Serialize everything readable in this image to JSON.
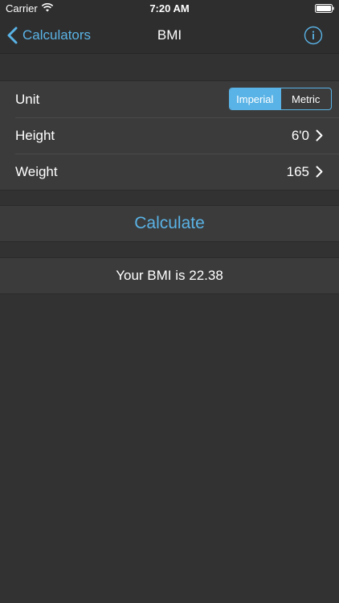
{
  "status_bar": {
    "carrier": "Carrier",
    "time": "7:20 AM"
  },
  "nav": {
    "back_label": "Calculators",
    "title": "BMI"
  },
  "settings": {
    "unit_label": "Unit",
    "unit_options": [
      "Imperial",
      "Metric"
    ],
    "unit_selected": "Imperial",
    "height_label": "Height",
    "height_value": "6'0",
    "weight_label": "Weight",
    "weight_value": "165"
  },
  "actions": {
    "calculate_label": "Calculate"
  },
  "result": {
    "text": "Your BMI is 22.38"
  },
  "colors": {
    "accent": "#5ab3e6",
    "background": "#323232",
    "cell": "#3b3b3b"
  }
}
